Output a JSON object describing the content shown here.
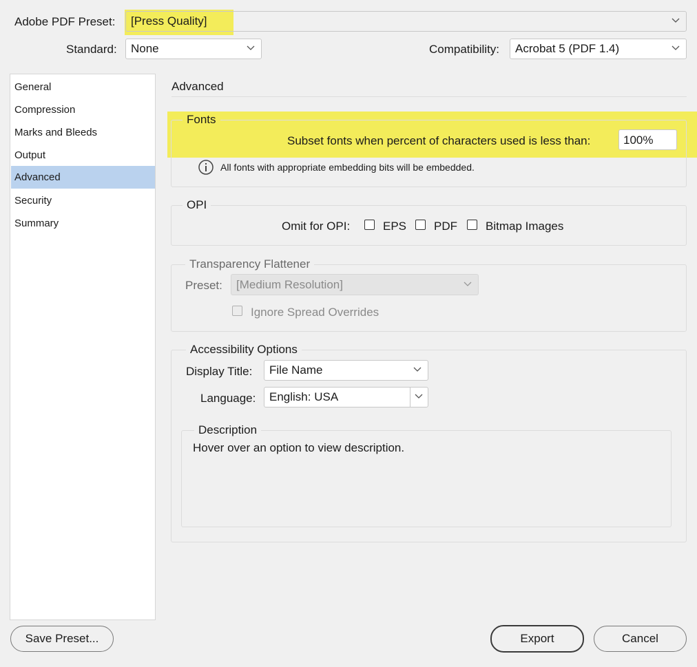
{
  "header": {
    "preset_label": "Adobe PDF Preset:",
    "preset_value": "[Press Quality]",
    "standard_label": "Standard:",
    "standard_value": "None",
    "compatibility_label": "Compatibility:",
    "compatibility_value": "Acrobat 5 (PDF 1.4)"
  },
  "sidebar": {
    "items": [
      {
        "label": "General"
      },
      {
        "label": "Compression"
      },
      {
        "label": "Marks and Bleeds"
      },
      {
        "label": "Output"
      },
      {
        "label": "Advanced",
        "selected": true
      },
      {
        "label": "Security"
      },
      {
        "label": "Summary"
      }
    ]
  },
  "panel": {
    "title": "Advanced",
    "fonts": {
      "legend": "Fonts",
      "subset_label": "Subset fonts when percent of characters used is less than:",
      "subset_value": "100%",
      "info": "All fonts with appropriate embedding bits will be embedded."
    },
    "opi": {
      "legend": "OPI",
      "omit_label": "Omit for OPI:",
      "eps": "EPS",
      "pdf": "PDF",
      "bitmap": "Bitmap Images"
    },
    "transparency": {
      "legend": "Transparency Flattener",
      "preset_label": "Preset:",
      "preset_value": "[Medium Resolution]",
      "ignore_label": "Ignore Spread Overrides"
    },
    "accessibility": {
      "legend": "Accessibility Options",
      "display_title_label": "Display Title:",
      "display_title_value": "File Name",
      "language_label": "Language:",
      "language_value": "English: USA"
    },
    "description": {
      "legend": "Description",
      "text": "Hover over an option to view description."
    }
  },
  "footer": {
    "save_preset": "Save Preset...",
    "export": "Export",
    "cancel": "Cancel"
  },
  "colors": {
    "highlight": "#f3ec5a",
    "selected_item": "#bad2ee"
  }
}
